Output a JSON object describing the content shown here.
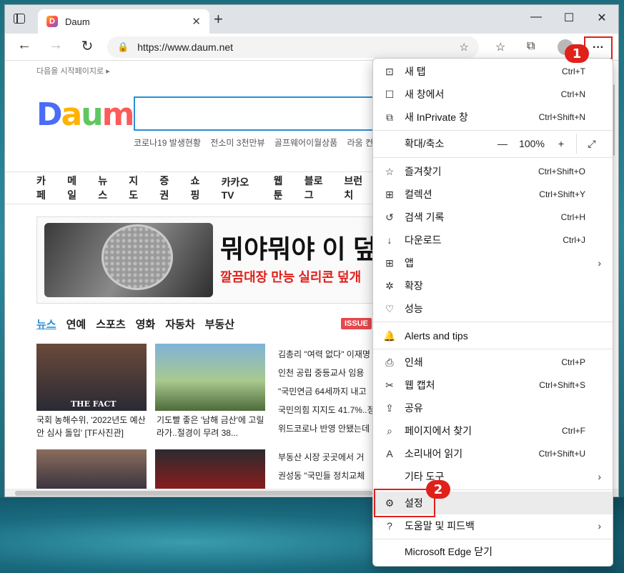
{
  "browser": {
    "tab_title": "Daum",
    "url": "https://www.daum.net",
    "win_minimize": "—",
    "win_maximize": "☐",
    "win_close": "✕",
    "new_tab": "+",
    "more_label": "···"
  },
  "page": {
    "start_link": "다음을 시작페이지로 ▸",
    "hot_keywords": [
      "코로나19 발생현황",
      "전소미 3천만뷰",
      "골프웨어이월상품",
      "라움 컨택"
    ],
    "gnb": [
      "카페",
      "메일",
      "뉴스",
      "지도",
      "증권",
      "쇼핑",
      "카카오TV",
      "웹툰",
      "블로그",
      "브런치"
    ],
    "banner_title": "뭐야뭐야 이 덮",
    "banner_sub": "깔끔대장 만능 실리콘 덮개",
    "news_tabs": [
      "뉴스",
      "연예",
      "스포츠",
      "영화",
      "자동차",
      "부동산"
    ],
    "issue_badge": "ISSUE",
    "thumb_cap_1": "국회 농해수위, '2022년도 예산안 심사 돌입' [TF사진관]",
    "thumb_cap_2": "기도빨 좋은 '남해 금산'에 고릴라가..절경이 무려 38...",
    "thumb_logo": "THE FACT",
    "headlines_top": [
      "김총리 \"여력 없다\" 이재명",
      "인천 공립 중등교사 임용",
      "\"국민연금 64세까지 내고",
      "국민의힘 지지도 41.7%..정",
      "위드코로나 반영 안됐는데"
    ],
    "headlines_bottom": [
      "부동산 시장 곳곳에서 거",
      "권성동 \"국민들 정치교체"
    ]
  },
  "menu": {
    "items": [
      {
        "icon": "⊡",
        "label": "새 탭",
        "shortcut": "Ctrl+T"
      },
      {
        "icon": "☐",
        "label": "새 창에서",
        "shortcut": "Ctrl+N"
      },
      {
        "icon": "⧉",
        "label": "새 InPrivate 창",
        "shortcut": "Ctrl+Shift+N"
      },
      {
        "icon": "",
        "label": "확대/축소",
        "shortcut": ""
      },
      {
        "icon": "☆",
        "label": "즐겨찾기",
        "shortcut": "Ctrl+Shift+O"
      },
      {
        "icon": "⊞",
        "label": "컬렉션",
        "shortcut": "Ctrl+Shift+Y"
      },
      {
        "icon": "↺",
        "label": "검색 기록",
        "shortcut": "Ctrl+H"
      },
      {
        "icon": "↓",
        "label": "다운로드",
        "shortcut": "Ctrl+J"
      },
      {
        "icon": "⊞",
        "label": "앱",
        "shortcut": ""
      },
      {
        "icon": "✲",
        "label": "확장",
        "shortcut": ""
      },
      {
        "icon": "♡",
        "label": "성능",
        "shortcut": ""
      },
      {
        "icon": "🔔",
        "label": "Alerts and tips",
        "shortcut": ""
      },
      {
        "icon": "⎙",
        "label": "인쇄",
        "shortcut": "Ctrl+P"
      },
      {
        "icon": "✂",
        "label": "웹 캡처",
        "shortcut": "Ctrl+Shift+S"
      },
      {
        "icon": "⇪",
        "label": "공유",
        "shortcut": ""
      },
      {
        "icon": "⌕",
        "label": "페이지에서 찾기",
        "shortcut": "Ctrl+F"
      },
      {
        "icon": "A",
        "label": "소리내어 읽기",
        "shortcut": "Ctrl+Shift+U"
      },
      {
        "icon": "",
        "label": "기타 도구",
        "shortcut": ""
      },
      {
        "icon": "⚙",
        "label": "설정",
        "shortcut": ""
      },
      {
        "icon": "?",
        "label": "도움말 및 피드백",
        "shortcut": ""
      },
      {
        "icon": "",
        "label": "Microsoft Edge 닫기",
        "shortcut": ""
      }
    ],
    "zoom": {
      "minus": "—",
      "value": "100%",
      "plus": "+",
      "fullscreen": "⤢"
    },
    "arrow": "›"
  },
  "annotations": {
    "badge_1": "1",
    "badge_2": "2"
  },
  "colors": {
    "highlight": "#e0201a",
    "accent": "#2a8fd6"
  }
}
